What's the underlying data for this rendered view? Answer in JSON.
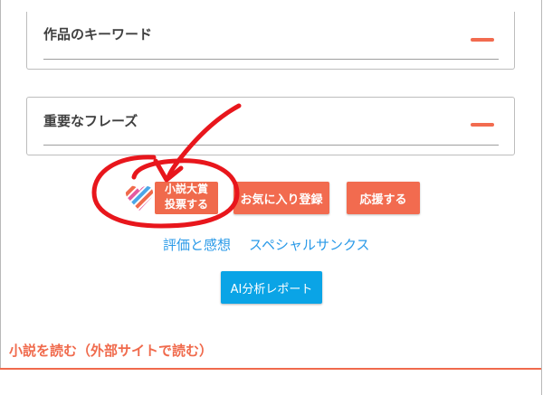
{
  "keywords_panel": {
    "title": "作品のキーワード",
    "toggle_icon": "minus-icon"
  },
  "phrases_panel": {
    "title": "重要なフレーズ",
    "toggle_icon": "minus-icon"
  },
  "vote_banner": {
    "line1": "小説大賞",
    "line2": "投票する",
    "logo_icon": "striped-heart-logo"
  },
  "buttons": {
    "favorite": "お気に入り登録",
    "support": "応援する",
    "ai_report": "AI分析レポート"
  },
  "links": {
    "review": "評価と感想",
    "special_thanks": "スペシャルサンクス"
  },
  "read_section": {
    "heading": "小説を読む（外部サイトで読む）"
  },
  "colors": {
    "accent_orange": "#f26b4f",
    "link_blue": "#2a9ae8",
    "ai_button_blue": "#0aa4e6",
    "annotation_red": "#e8161c"
  }
}
